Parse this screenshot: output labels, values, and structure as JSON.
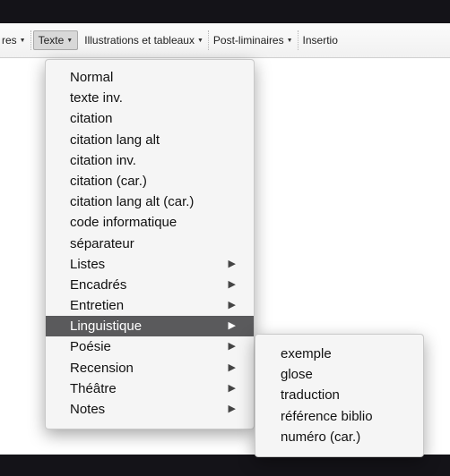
{
  "toolbar": {
    "items": [
      {
        "label": "res",
        "caret": "▼"
      },
      {
        "label": "Texte",
        "caret": "▼"
      },
      {
        "label": "Illustrations et tableaux",
        "caret": "▼"
      },
      {
        "label": "Post-liminaires",
        "caret": "▼"
      },
      {
        "label": "Insertio"
      }
    ]
  },
  "menu": {
    "items": [
      {
        "label": "Normal"
      },
      {
        "label": "texte inv."
      },
      {
        "label": "citation"
      },
      {
        "label": "citation lang alt"
      },
      {
        "label": "citation inv."
      },
      {
        "label": "citation (car.)"
      },
      {
        "label": "citation lang alt (car.)"
      },
      {
        "label": "code informatique"
      },
      {
        "label": "séparateur"
      },
      {
        "label": "Listes",
        "arrow": "▶"
      },
      {
        "label": "Encadrés",
        "arrow": "▶"
      },
      {
        "label": "Entretien",
        "arrow": "▶"
      },
      {
        "label": "Linguistique",
        "arrow": "▶"
      },
      {
        "label": "Poésie",
        "arrow": "▶"
      },
      {
        "label": "Recension",
        "arrow": "▶"
      },
      {
        "label": "Théâtre",
        "arrow": "▶"
      },
      {
        "label": "Notes",
        "arrow": "▶"
      }
    ]
  },
  "submenu": {
    "items": [
      {
        "label": "exemple"
      },
      {
        "label": "glose"
      },
      {
        "label": "traduction"
      },
      {
        "label": "référence biblio"
      },
      {
        "label": "numéro (car.)"
      }
    ]
  },
  "colors": {
    "highlight": "#5a5a5c",
    "menu_bg": "#f5f5f5"
  }
}
